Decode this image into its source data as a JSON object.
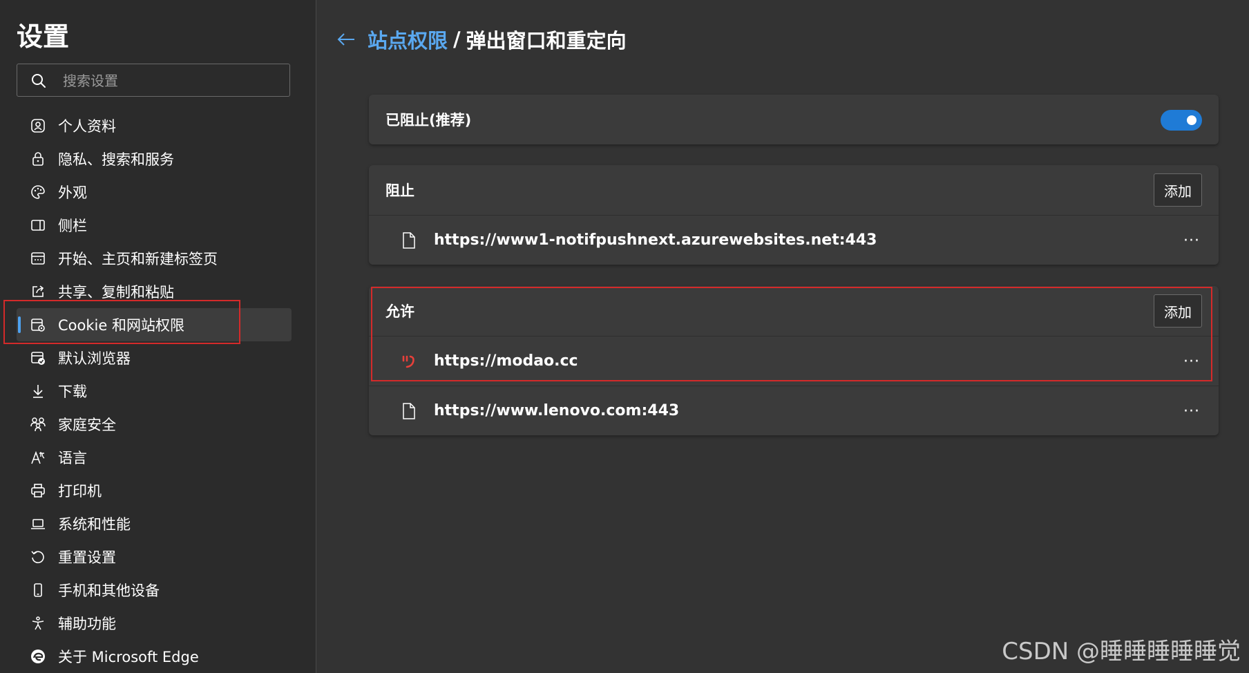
{
  "sidebar": {
    "title": "设置",
    "search_placeholder": "搜索设置",
    "items": [
      {
        "label": "个人资料",
        "icon": "profile-icon"
      },
      {
        "label": "隐私、搜索和服务",
        "icon": "lock-icon"
      },
      {
        "label": "外观",
        "icon": "palette-icon"
      },
      {
        "label": "侧栏",
        "icon": "sidebar-icon"
      },
      {
        "label": "开始、主页和新建标签页",
        "icon": "home-tab-icon"
      },
      {
        "label": "共享、复制和粘贴",
        "icon": "share-icon"
      },
      {
        "label": "Cookie 和网站权限",
        "icon": "cookie-site-icon",
        "active": true
      },
      {
        "label": "默认浏览器",
        "icon": "default-browser-icon"
      },
      {
        "label": "下载",
        "icon": "download-icon"
      },
      {
        "label": "家庭安全",
        "icon": "family-icon"
      },
      {
        "label": "语言",
        "icon": "language-icon"
      },
      {
        "label": "打印机",
        "icon": "printer-icon"
      },
      {
        "label": "系统和性能",
        "icon": "laptop-icon"
      },
      {
        "label": "重置设置",
        "icon": "reset-icon"
      },
      {
        "label": "手机和其他设备",
        "icon": "phone-icon"
      },
      {
        "label": "辅助功能",
        "icon": "accessibility-icon"
      },
      {
        "label": "关于 Microsoft Edge",
        "icon": "edge-icon"
      }
    ]
  },
  "header": {
    "breadcrumb_link": "站点权限",
    "separator": "/",
    "current": "弹出窗口和重定向"
  },
  "blocked_toggle": {
    "label": "已阻止(推荐)",
    "on": true
  },
  "block_section": {
    "title": "阻止",
    "add_label": "添加",
    "sites": [
      {
        "url": "https://www1-notifpushnext.azurewebsites.net:443",
        "icon": "file-icon",
        "more": "···"
      }
    ]
  },
  "allow_section": {
    "title": "允许",
    "add_label": "添加",
    "sites": [
      {
        "url": "https://modao.cc",
        "icon": "modao-favicon",
        "more": "···"
      },
      {
        "url": "https://www.lenovo.com:443",
        "icon": "file-icon",
        "more": "···"
      }
    ]
  },
  "colors": {
    "accent": "#1f7bd6",
    "link": "#5aa8f0",
    "highlight": "#d42a2a",
    "modao_brand": "#e8403a"
  },
  "watermark": "CSDN @睡睡睡睡睡觉"
}
